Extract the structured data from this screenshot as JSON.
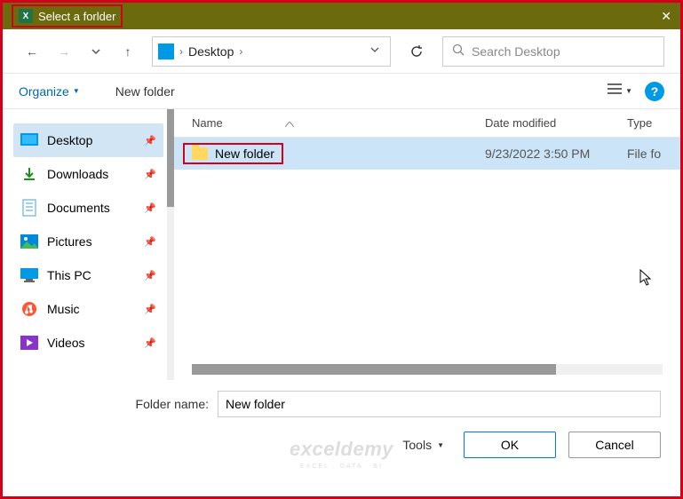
{
  "titlebar": {
    "title": "Select a forlder"
  },
  "breadcrumb": {
    "location": "Desktop"
  },
  "search": {
    "placeholder": "Search Desktop"
  },
  "toolbar": {
    "organize": "Organize",
    "newfolder": "New folder"
  },
  "sidebar": {
    "items": [
      {
        "label": "Desktop"
      },
      {
        "label": "Downloads"
      },
      {
        "label": "Documents"
      },
      {
        "label": "Pictures"
      },
      {
        "label": "This PC"
      },
      {
        "label": "Music"
      },
      {
        "label": "Videos"
      }
    ]
  },
  "columns": {
    "name": "Name",
    "date": "Date modified",
    "type": "Type"
  },
  "files": [
    {
      "name": "New folder",
      "date": "9/23/2022 3:50 PM",
      "type": "File fo"
    }
  ],
  "folder_field": {
    "label": "Folder name:",
    "value": "New folder"
  },
  "buttons": {
    "tools": "Tools",
    "ok": "OK",
    "cancel": "Cancel"
  },
  "watermark": {
    "main": "exceldemy",
    "sub": "EXCEL · DATA · BI"
  }
}
